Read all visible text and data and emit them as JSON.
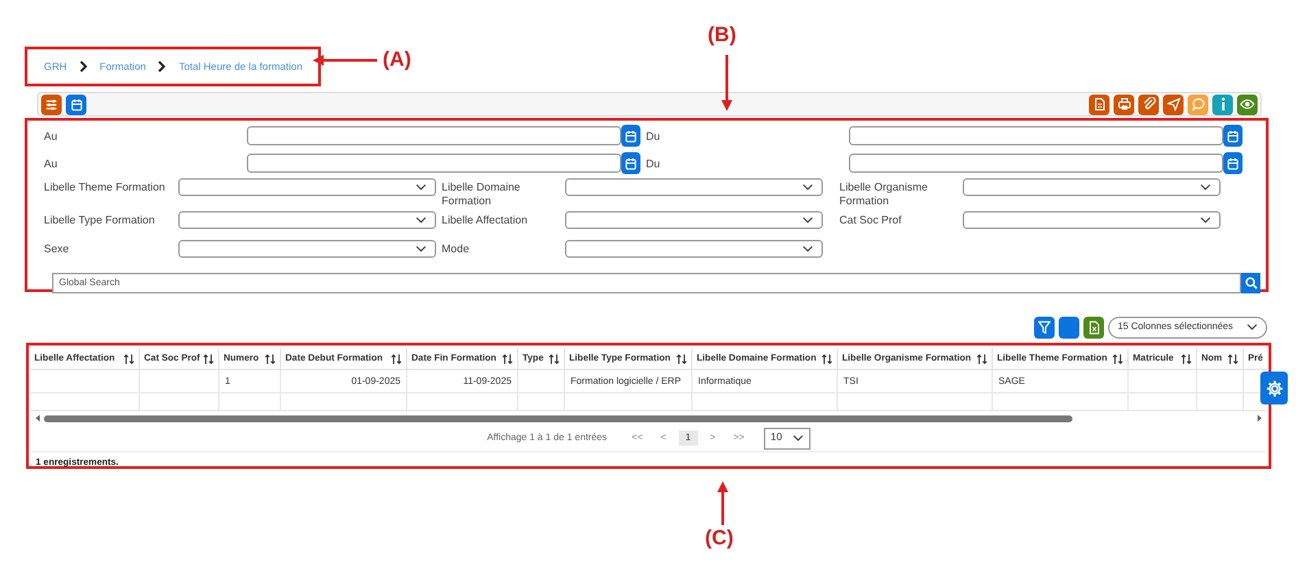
{
  "annotations": [
    {
      "label": "(A)"
    },
    {
      "label": "(B)"
    },
    {
      "label": "(C)"
    }
  ],
  "breadcrumb": [
    "GRH",
    "Formation",
    "Total Heure de la formation"
  ],
  "toolbar": {
    "left": [
      {
        "kind": "sliders",
        "color": "#d35400"
      },
      {
        "kind": "calendar",
        "color": "#0b74de"
      }
    ],
    "right": [
      {
        "kind": "document",
        "color": "#d35400"
      },
      {
        "kind": "print",
        "color": "#d35400"
      },
      {
        "kind": "attach",
        "color": "#d35400"
      },
      {
        "kind": "send",
        "color": "#d35400"
      },
      {
        "kind": "comment",
        "color": "#f7a440"
      },
      {
        "kind": "info",
        "color": "#17a2b8"
      },
      {
        "kind": "eye",
        "color": "#4a8b1a"
      }
    ]
  },
  "date_filters": [
    {
      "label": "Au"
    },
    {
      "label": "Du"
    },
    {
      "label": "Au"
    },
    {
      "label": "Du"
    }
  ],
  "select_filters": [
    {
      "label": "Libelle Theme Formation"
    },
    {
      "label": "Libelle Domaine Formation"
    },
    {
      "label": "Libelle Organisme Formation"
    },
    {
      "label": "Libelle Type Formation"
    },
    {
      "label": "Libelle Affectation"
    },
    {
      "label": "Cat Soc Prof"
    },
    {
      "label": "Sexe"
    },
    {
      "label": "Mode"
    }
  ],
  "global_search": {
    "placeholder": "Global Search"
  },
  "table_toolbar": {
    "buttons": [
      {
        "kind": "filter",
        "color": "#0b74de"
      },
      {
        "kind": "blank",
        "color": "#0b74de"
      },
      {
        "kind": "excel",
        "color": "#4a8b1a"
      }
    ],
    "columns_select": "15 Colonnes sélectionnées"
  },
  "table": {
    "columns": [
      "Libelle Affectation",
      "Cat Soc Prof",
      "Numero",
      "Date Debut Formation",
      "Date Fin Formation",
      "Type",
      "Libelle Type Formation",
      "Libelle Domaine Formation",
      "Libelle Organisme Formation",
      "Libelle Theme Formation",
      "Matricule",
      "Nom",
      "Pré"
    ],
    "rows": [
      [
        "",
        "",
        "1",
        "01-09-2025",
        "11-09-2025",
        "",
        "Formation logicielle / ERP",
        "Informatique",
        "TSI",
        "SAGE",
        "",
        "",
        ""
      ]
    ]
  },
  "pagination": {
    "info": "Affichage 1 à 1 de 1 entrées",
    "first": "<<",
    "prev": "<",
    "pages": [
      {
        "label": "1",
        "selected": true
      }
    ],
    "next": ">",
    "last": ">>",
    "page_size": "10"
  },
  "footer": "1 enregistrements."
}
